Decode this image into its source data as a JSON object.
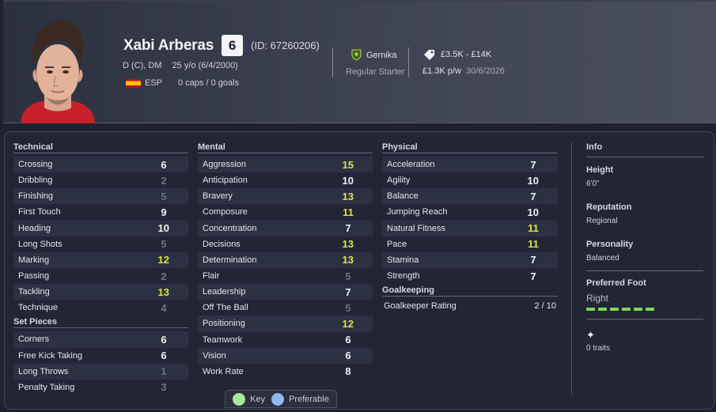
{
  "player": {
    "name": "Xabi Arberas",
    "ability": "6",
    "id_text": "(ID: 67260206)",
    "positions": "D (C), DM",
    "age": "25 y/o (6/4/2000)",
    "nation": "ESP",
    "caps": "0 caps / 0 goals"
  },
  "club": {
    "name": "Gernika",
    "status": "Regular Starter"
  },
  "finance": {
    "value": "£3.5K - £14K",
    "wage": "£1.3K p/w",
    "contract_end": "30/6/2026"
  },
  "colors": {
    "low": "#6c7280",
    "mid": "#f0f1f4",
    "high": "#d6e54a",
    "key": "#a8e6a1",
    "preferable": "#8fb8ef"
  },
  "technical": {
    "title": "Technical",
    "attrs": [
      {
        "label": "Crossing",
        "value": "6"
      },
      {
        "label": "Dribbling",
        "value": "2"
      },
      {
        "label": "Finishing",
        "value": "5"
      },
      {
        "label": "First Touch",
        "value": "9"
      },
      {
        "label": "Heading",
        "value": "10"
      },
      {
        "label": "Long Shots",
        "value": "5"
      },
      {
        "label": "Marking",
        "value": "12"
      },
      {
        "label": "Passing",
        "value": "2"
      },
      {
        "label": "Tackling",
        "value": "13"
      },
      {
        "label": "Technique",
        "value": "4"
      }
    ]
  },
  "set_pieces": {
    "title": "Set Pieces",
    "attrs": [
      {
        "label": "Corners",
        "value": "6"
      },
      {
        "label": "Free Kick Taking",
        "value": "6"
      },
      {
        "label": "Long Throws",
        "value": "1"
      },
      {
        "label": "Penalty Taking",
        "value": "3"
      }
    ]
  },
  "mental": {
    "title": "Mental",
    "attrs": [
      {
        "label": "Aggression",
        "value": "15"
      },
      {
        "label": "Anticipation",
        "value": "10"
      },
      {
        "label": "Bravery",
        "value": "13"
      },
      {
        "label": "Composure",
        "value": "11"
      },
      {
        "label": "Concentration",
        "value": "7"
      },
      {
        "label": "Decisions",
        "value": "13"
      },
      {
        "label": "Determination",
        "value": "13"
      },
      {
        "label": "Flair",
        "value": "5"
      },
      {
        "label": "Leadership",
        "value": "7"
      },
      {
        "label": "Off The Ball",
        "value": "5"
      },
      {
        "label": "Positioning",
        "value": "12"
      },
      {
        "label": "Teamwork",
        "value": "6"
      },
      {
        "label": "Vision",
        "value": "6"
      },
      {
        "label": "Work Rate",
        "value": "8"
      }
    ]
  },
  "physical": {
    "title": "Physical",
    "attrs": [
      {
        "label": "Acceleration",
        "value": "7"
      },
      {
        "label": "Agility",
        "value": "10"
      },
      {
        "label": "Balance",
        "value": "7"
      },
      {
        "label": "Jumping Reach",
        "value": "10"
      },
      {
        "label": "Natural Fitness",
        "value": "11"
      },
      {
        "label": "Pace",
        "value": "11"
      },
      {
        "label": "Stamina",
        "value": "7"
      },
      {
        "label": "Strength",
        "value": "7"
      }
    ]
  },
  "goalkeeping": {
    "title": "Goalkeeping",
    "label": "Goalkeeper Rating",
    "value": "2 / 10"
  },
  "legend": {
    "key": "Key",
    "preferable": "Preferable"
  },
  "info": {
    "title": "Info",
    "height_label": "Height",
    "height": "6'0\"",
    "reputation_label": "Reputation",
    "reputation": "Regional",
    "personality_label": "Personality",
    "personality": "Balanced",
    "foot_label": "Preferred Foot",
    "foot": "Right",
    "foot_strength": 1.0,
    "traits_icon": "sparkle-icon",
    "traits": "0 traits"
  }
}
